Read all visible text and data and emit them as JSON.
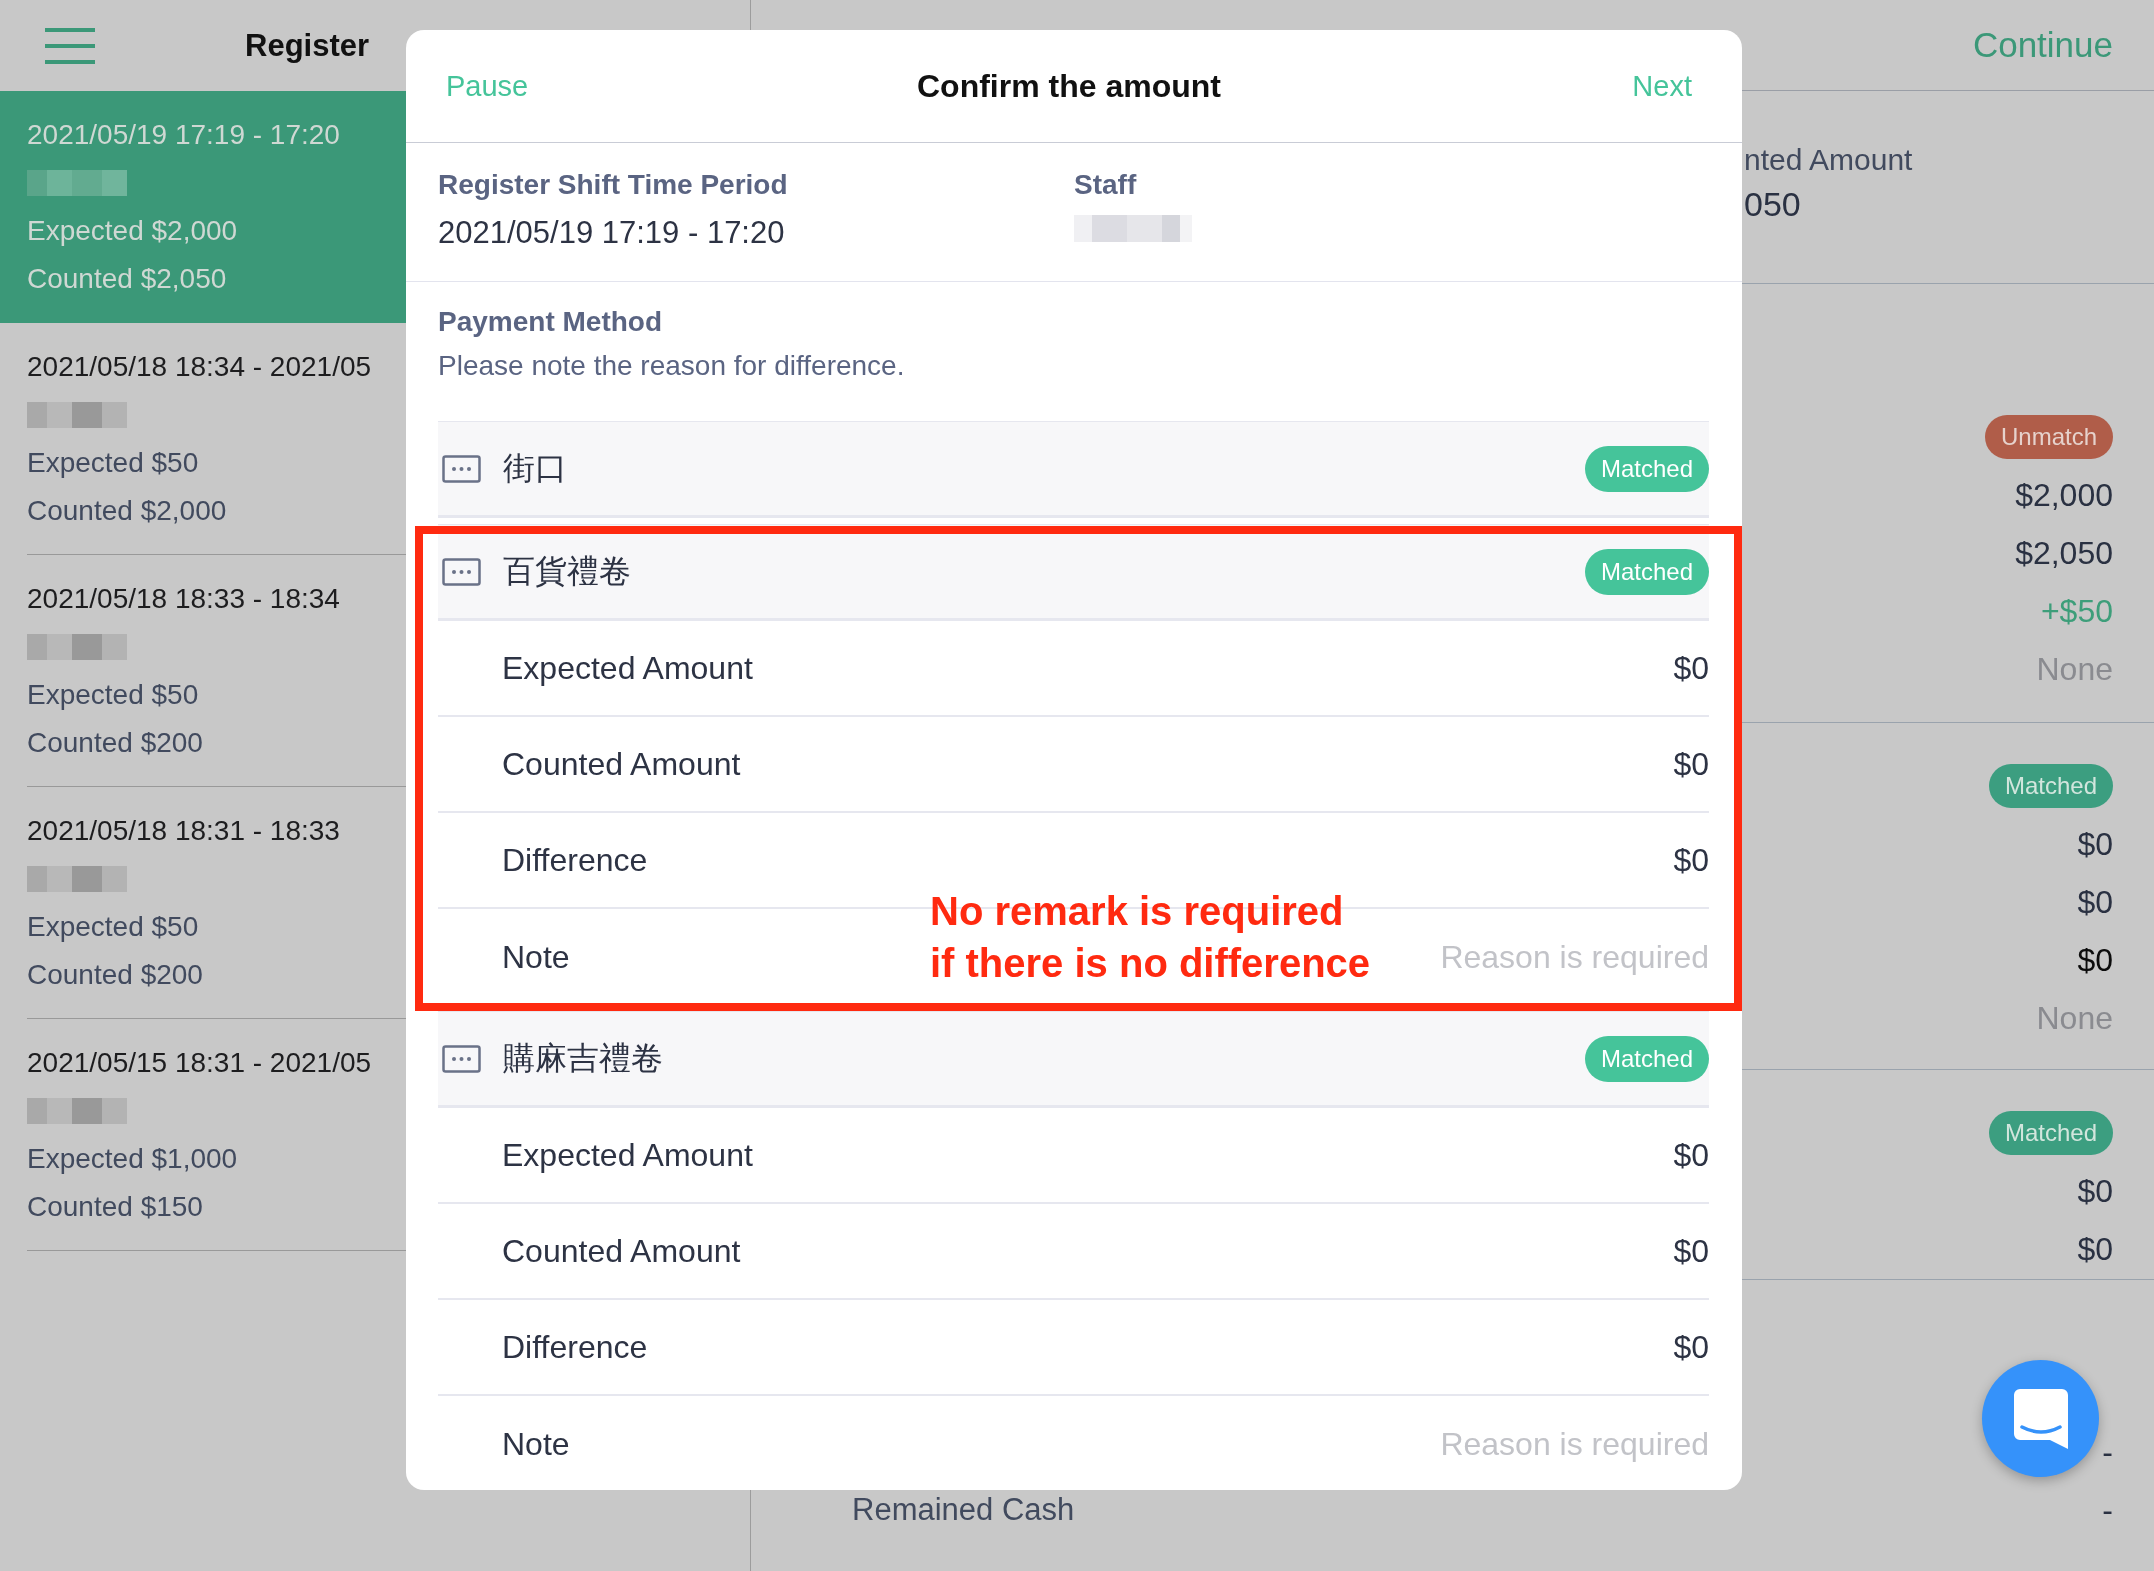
{
  "sidebar": {
    "title": "Register",
    "items": [
      {
        "period": "2021/05/19 17:19 - 17:20",
        "expected": "Expected $2,000",
        "counted": "Counted $2,050",
        "selected": true
      },
      {
        "period": "2021/05/18 18:34 - 2021/05",
        "expected": "Expected $50",
        "counted": "Counted $2,000",
        "selected": false
      },
      {
        "period": "2021/05/18 18:33 - 18:34",
        "expected": "Expected $50",
        "counted": "Counted $200",
        "selected": false
      },
      {
        "period": "2021/05/18 18:31 - 18:33",
        "expected": "Expected $50",
        "counted": "Counted $200",
        "selected": false
      },
      {
        "period": "2021/05/15 18:31 - 2021/05",
        "expected": "Expected $1,000",
        "counted": "Counted $150",
        "selected": false
      }
    ]
  },
  "detail": {
    "action": "Continue",
    "summary": {
      "label": "nted Amount",
      "value": "050"
    },
    "sections": [
      {
        "badge": {
          "label": "Unmatch",
          "kind": "unmatch"
        },
        "rows": [
          {
            "value": "$2,000",
            "kind": "amount"
          },
          {
            "value": "$2,050",
            "kind": "amount"
          },
          {
            "value": "+$50",
            "kind": "positive"
          },
          {
            "value": "None",
            "kind": "empty"
          }
        ]
      },
      {
        "badge": {
          "label": "Matched",
          "kind": "matched"
        },
        "rows": [
          {
            "value": "$0",
            "kind": "amount"
          },
          {
            "value": "$0",
            "kind": "amount"
          },
          {
            "value": "$0",
            "kind": "strong"
          },
          {
            "value": "None",
            "kind": "empty"
          }
        ]
      },
      {
        "badge": {
          "label": "Matched",
          "kind": "matched"
        },
        "rows": [
          {
            "value": "$0",
            "kind": "amount"
          },
          {
            "value": "$0",
            "kind": "amount"
          }
        ]
      },
      {
        "rows": [
          {
            "value": "-",
            "kind": "amount"
          },
          {
            "label": "Remained Cash",
            "value": "-",
            "kind": "amount"
          }
        ]
      }
    ]
  },
  "dialog": {
    "left_action": "Pause",
    "title": "Confirm the amount",
    "right_action": "Next",
    "period": {
      "label": "Register Shift Time Period",
      "value": "2021/05/19 17:19 - 17:20"
    },
    "staff": {
      "label": "Staff"
    },
    "payment": {
      "label": "Payment Method",
      "hint": "Please note the reason for difference."
    },
    "groups": [
      {
        "name": "街口",
        "status": {
          "label": "Matched",
          "kind": "matched"
        }
      },
      {
        "name": "百貨禮卷",
        "status": {
          "label": "Matched",
          "kind": "matched"
        },
        "rows": [
          {
            "label": "Expected Amount",
            "value": "$0"
          },
          {
            "label": "Counted Amount",
            "value": "$0"
          },
          {
            "label": "Difference",
            "value": "$0"
          },
          {
            "label": "Note",
            "placeholder": "Reason is required"
          }
        ]
      },
      {
        "name": "購麻吉禮卷",
        "status": {
          "label": "Matched",
          "kind": "matched"
        },
        "rows": [
          {
            "label": "Expected Amount",
            "value": "$0"
          },
          {
            "label": "Counted Amount",
            "value": "$0"
          },
          {
            "label": "Difference",
            "value": "$0"
          },
          {
            "label": "Note",
            "placeholder": "Reason is required"
          }
        ]
      }
    ],
    "annotation": {
      "text": "No remark is required\nif there is no difference"
    }
  }
}
